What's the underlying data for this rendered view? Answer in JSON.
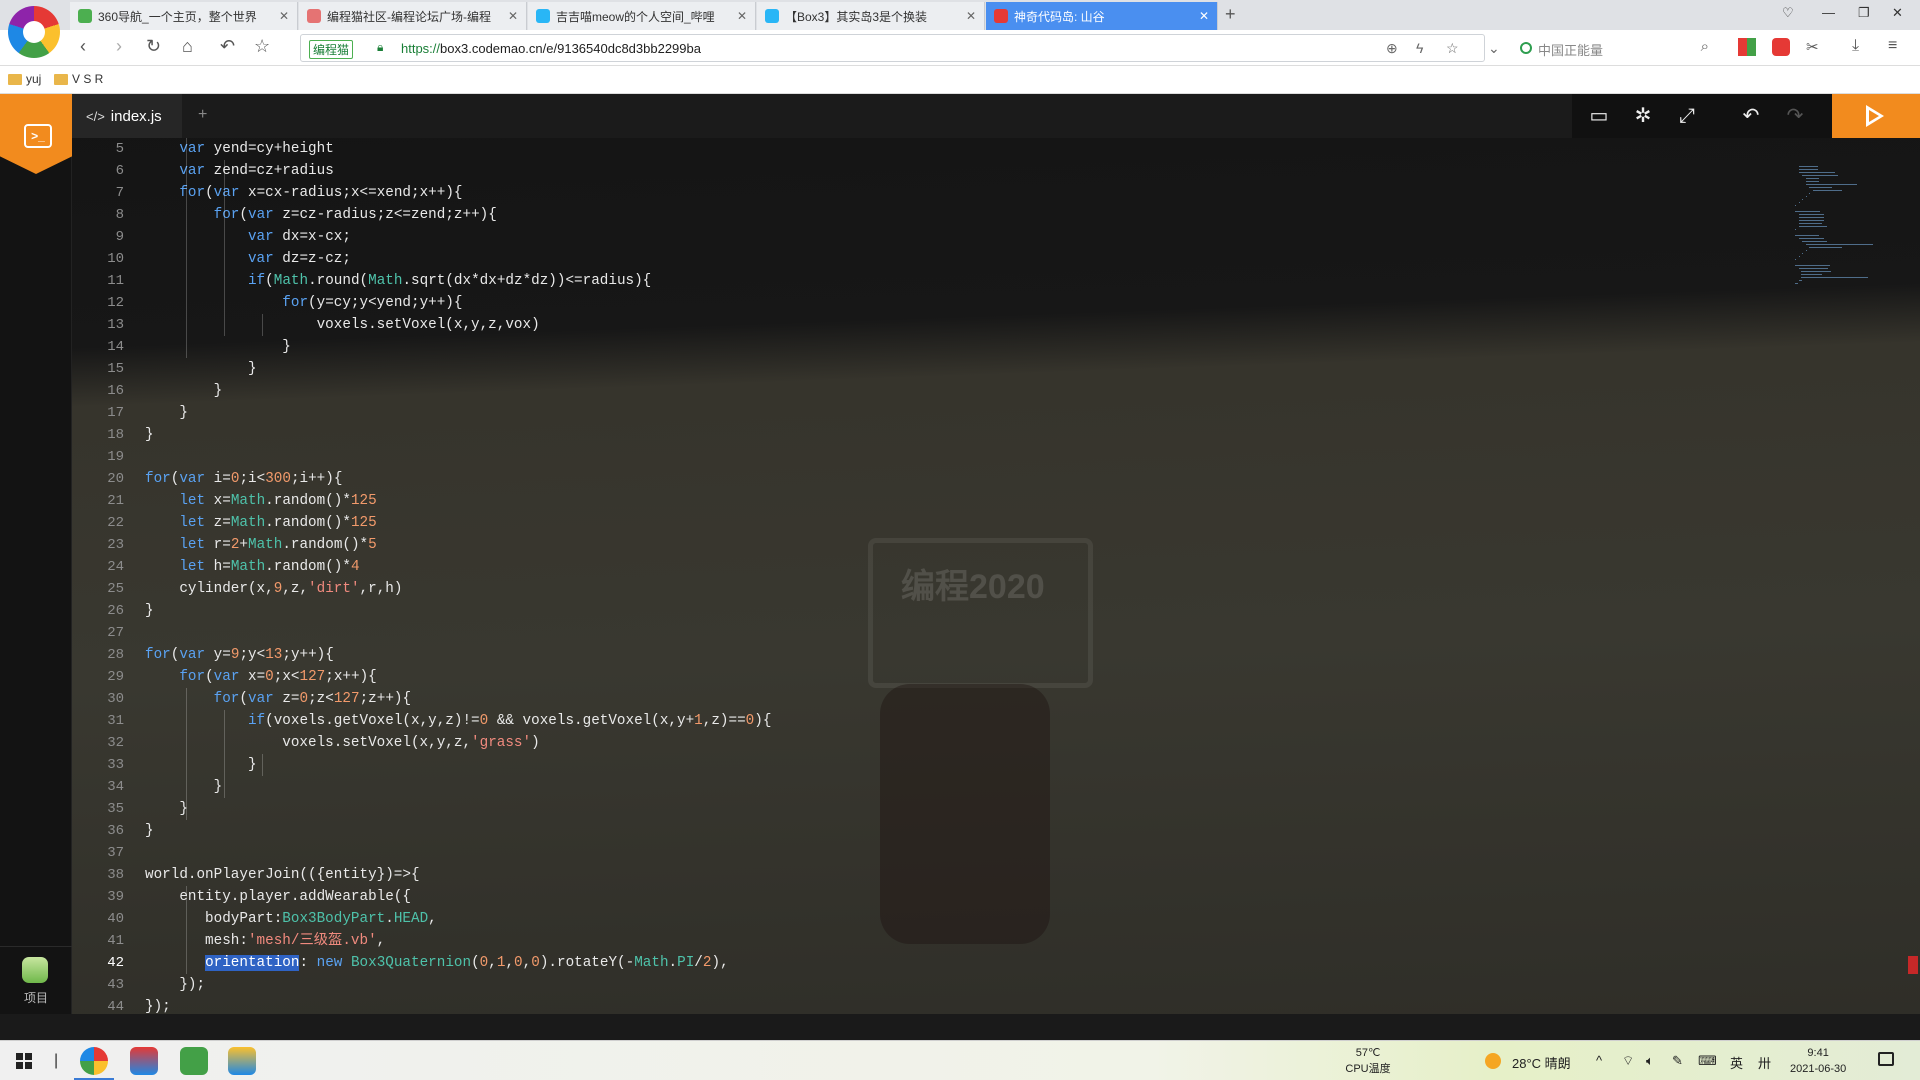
{
  "browser": {
    "tabs": [
      {
        "title": "360导航_一个主页，整个世界",
        "favicon_color": "#4caf50"
      },
      {
        "title": "编程猫社区-编程论坛广场-编程",
        "favicon_color": "#e57373"
      },
      {
        "title": "吉吉喵meow的个人空间_哔哩",
        "favicon_color": "#29b6f6"
      },
      {
        "title": "【Box3】其实岛3是个换装",
        "favicon_color": "#29b6f6"
      },
      {
        "title": "神奇代码岛: 山谷",
        "favicon_color": "#e53935"
      }
    ],
    "new_tab": "+",
    "url_badge": "编程猫",
    "url_scheme": "https://",
    "url_rest": "box3.codemao.cn/e/9136540dc8d3bb2299ba",
    "search_placeholder": "中国正能量",
    "bookmarks": [
      "yuj",
      "V S R"
    ]
  },
  "editor": {
    "file_tab": "index.js",
    "add_tab": "+",
    "watermark": "编程2020",
    "project_label": "项目",
    "current_line": 42,
    "lines": [
      {
        "n": 5,
        "tokens": [
          [
            "    ",
            ""
          ],
          [
            "var",
            "kw"
          ],
          [
            " yend=cy+height",
            ""
          ]
        ]
      },
      {
        "n": 6,
        "tokens": [
          [
            "    ",
            ""
          ],
          [
            "var",
            "kw"
          ],
          [
            " zend=cz+radius",
            ""
          ]
        ]
      },
      {
        "n": 7,
        "tokens": [
          [
            "    ",
            ""
          ],
          [
            "for",
            "kw"
          ],
          [
            "(",
            ""
          ],
          [
            "var",
            "kw"
          ],
          [
            " x=cx-radius;x<=xend;x++){",
            ""
          ]
        ]
      },
      {
        "n": 8,
        "tokens": [
          [
            "        ",
            ""
          ],
          [
            "for",
            "kw"
          ],
          [
            "(",
            ""
          ],
          [
            "var",
            "kw"
          ],
          [
            " z=cz-radius;z<=zend;z++){",
            ""
          ]
        ]
      },
      {
        "n": 9,
        "tokens": [
          [
            "            ",
            ""
          ],
          [
            "var",
            "kw"
          ],
          [
            " dx=x-cx;",
            ""
          ]
        ]
      },
      {
        "n": 10,
        "tokens": [
          [
            "            ",
            ""
          ],
          [
            "var",
            "kw"
          ],
          [
            " dz=z-cz;",
            ""
          ]
        ]
      },
      {
        "n": 11,
        "tokens": [
          [
            "            ",
            ""
          ],
          [
            "if",
            "kw"
          ],
          [
            "(",
            ""
          ],
          [
            "Math",
            "cls"
          ],
          [
            ".round(",
            ""
          ],
          [
            "Math",
            "cls"
          ],
          [
            ".sqrt(dx*dx+dz*dz))<=radius){",
            ""
          ]
        ]
      },
      {
        "n": 12,
        "tokens": [
          [
            "                ",
            ""
          ],
          [
            "for",
            "kw"
          ],
          [
            "(y=cy;y<yend;y++){",
            ""
          ]
        ]
      },
      {
        "n": 13,
        "tokens": [
          [
            "                    voxels.setVoxel(x,y,z,vox)",
            ""
          ]
        ]
      },
      {
        "n": 14,
        "tokens": [
          [
            "                }",
            ""
          ]
        ]
      },
      {
        "n": 15,
        "tokens": [
          [
            "            }",
            ""
          ]
        ]
      },
      {
        "n": 16,
        "tokens": [
          [
            "        }",
            ""
          ]
        ]
      },
      {
        "n": 17,
        "tokens": [
          [
            "    }",
            ""
          ]
        ]
      },
      {
        "n": 18,
        "tokens": [
          [
            "}",
            ""
          ]
        ]
      },
      {
        "n": 19,
        "tokens": [
          [
            "",
            ""
          ]
        ]
      },
      {
        "n": 20,
        "tokens": [
          [
            "for",
            "kw"
          ],
          [
            "(",
            ""
          ],
          [
            "var",
            "kw"
          ],
          [
            " i=",
            ""
          ],
          [
            "0",
            "num"
          ],
          [
            ";i<",
            ""
          ],
          [
            "300",
            "num"
          ],
          [
            ";i++){",
            ""
          ]
        ]
      },
      {
        "n": 21,
        "tokens": [
          [
            "    ",
            ""
          ],
          [
            "let",
            "kw"
          ],
          [
            " x=",
            ""
          ],
          [
            "Math",
            "cls"
          ],
          [
            ".random()*",
            ""
          ],
          [
            "125",
            "num"
          ]
        ]
      },
      {
        "n": 22,
        "tokens": [
          [
            "    ",
            ""
          ],
          [
            "let",
            "kw"
          ],
          [
            " z=",
            ""
          ],
          [
            "Math",
            "cls"
          ],
          [
            ".random()*",
            ""
          ],
          [
            "125",
            "num"
          ]
        ]
      },
      {
        "n": 23,
        "tokens": [
          [
            "    ",
            ""
          ],
          [
            "let",
            "kw"
          ],
          [
            " r=",
            ""
          ],
          [
            "2",
            "num"
          ],
          [
            "+",
            ""
          ],
          [
            "Math",
            "cls"
          ],
          [
            ".random()*",
            ""
          ],
          [
            "5",
            "num"
          ]
        ]
      },
      {
        "n": 24,
        "tokens": [
          [
            "    ",
            ""
          ],
          [
            "let",
            "kw"
          ],
          [
            " h=",
            ""
          ],
          [
            "Math",
            "cls"
          ],
          [
            ".random()*",
            ""
          ],
          [
            "4",
            "num"
          ]
        ]
      },
      {
        "n": 25,
        "tokens": [
          [
            "    cylinder(x,",
            ""
          ],
          [
            "9",
            "num"
          ],
          [
            ",z,",
            ""
          ],
          [
            "'dirt'",
            "str"
          ],
          [
            ",r,h)",
            ""
          ]
        ]
      },
      {
        "n": 26,
        "tokens": [
          [
            "}",
            ""
          ]
        ]
      },
      {
        "n": 27,
        "tokens": [
          [
            "",
            ""
          ]
        ]
      },
      {
        "n": 28,
        "tokens": [
          [
            "for",
            "kw"
          ],
          [
            "(",
            ""
          ],
          [
            "var",
            "kw"
          ],
          [
            " y=",
            ""
          ],
          [
            "9",
            "num"
          ],
          [
            ";y<",
            ""
          ],
          [
            "13",
            "num"
          ],
          [
            ";y++){",
            ""
          ]
        ]
      },
      {
        "n": 29,
        "tokens": [
          [
            "    ",
            ""
          ],
          [
            "for",
            "kw"
          ],
          [
            "(",
            ""
          ],
          [
            "var",
            "kw"
          ],
          [
            " x=",
            ""
          ],
          [
            "0",
            "num"
          ],
          [
            ";x<",
            ""
          ],
          [
            "127",
            "num"
          ],
          [
            ";x++){",
            ""
          ]
        ]
      },
      {
        "n": 30,
        "tokens": [
          [
            "        ",
            ""
          ],
          [
            "for",
            "kw"
          ],
          [
            "(",
            ""
          ],
          [
            "var",
            "kw"
          ],
          [
            " z=",
            ""
          ],
          [
            "0",
            "num"
          ],
          [
            ";z<",
            ""
          ],
          [
            "127",
            "num"
          ],
          [
            ";z++){",
            ""
          ]
        ]
      },
      {
        "n": 31,
        "tokens": [
          [
            "            ",
            ""
          ],
          [
            "if",
            "kw"
          ],
          [
            "(voxels.getVoxel(x,y,z)!=",
            ""
          ],
          [
            "0",
            "num"
          ],
          [
            " && voxels.getVoxel(x,y+",
            ""
          ],
          [
            "1",
            "num"
          ],
          [
            ",z)==",
            ""
          ],
          [
            "0",
            "num"
          ],
          [
            "){",
            ""
          ]
        ]
      },
      {
        "n": 32,
        "tokens": [
          [
            "                voxels.setVoxel(x,y,z,",
            ""
          ],
          [
            "'grass'",
            "str"
          ],
          [
            ")",
            ""
          ]
        ]
      },
      {
        "n": 33,
        "tokens": [
          [
            "            }",
            ""
          ]
        ]
      },
      {
        "n": 34,
        "tokens": [
          [
            "        }",
            ""
          ]
        ]
      },
      {
        "n": 35,
        "tokens": [
          [
            "    }",
            ""
          ]
        ]
      },
      {
        "n": 36,
        "tokens": [
          [
            "}",
            ""
          ]
        ]
      },
      {
        "n": 37,
        "tokens": [
          [
            "",
            ""
          ]
        ]
      },
      {
        "n": 38,
        "tokens": [
          [
            "world.onPlayerJoin(({entity})=>{",
            ""
          ]
        ]
      },
      {
        "n": 39,
        "tokens": [
          [
            "    entity.player.addWearable({",
            ""
          ]
        ]
      },
      {
        "n": 40,
        "tokens": [
          [
            "       bodyPart:",
            ""
          ],
          [
            "Box3BodyPart",
            "cls"
          ],
          [
            ".",
            ""
          ],
          [
            "HEAD",
            "cls"
          ],
          [
            ",",
            ""
          ]
        ]
      },
      {
        "n": 41,
        "tokens": [
          [
            "       mesh:",
            ""
          ],
          [
            "'mesh/三级盔.vb'",
            "str"
          ],
          [
            ",",
            ""
          ]
        ]
      },
      {
        "n": 42,
        "tokens": [
          [
            "       ",
            ""
          ],
          [
            "orientation",
            "sel"
          ],
          [
            ": ",
            ""
          ],
          [
            "new",
            "kw"
          ],
          [
            " ",
            ""
          ],
          [
            "Box3Quaternion",
            "cls"
          ],
          [
            "(",
            ""
          ],
          [
            "0",
            "num"
          ],
          [
            ",",
            ""
          ],
          [
            "1",
            "num"
          ],
          [
            ",",
            ""
          ],
          [
            "0",
            "num"
          ],
          [
            ",",
            ""
          ],
          [
            "0",
            "num"
          ],
          [
            ").rotateY(-",
            ""
          ],
          [
            "Math",
            "cls"
          ],
          [
            ".",
            ""
          ],
          [
            "PI",
            "cls"
          ],
          [
            "/",
            ""
          ],
          [
            "2",
            "num"
          ],
          [
            "),",
            ""
          ]
        ]
      },
      {
        "n": 43,
        "tokens": [
          [
            "    });",
            ""
          ]
        ]
      },
      {
        "n": 44,
        "tokens": [
          [
            "});",
            ""
          ]
        ]
      }
    ]
  },
  "taskbar": {
    "cpu_temp": "57℃",
    "cpu_label": "CPU温度",
    "weather": "28°C  晴朗",
    "ime": "英",
    "time": "9:41",
    "date": "2021-06-30"
  },
  "colors": {
    "accent": "#f28b1e",
    "keyword": "#5aa2f2",
    "number": "#f29a6b",
    "string": "#f08a7e",
    "class": "#4ec2aa",
    "active_tab": "#4a8ff0",
    "annotation": "#e31b1b"
  }
}
